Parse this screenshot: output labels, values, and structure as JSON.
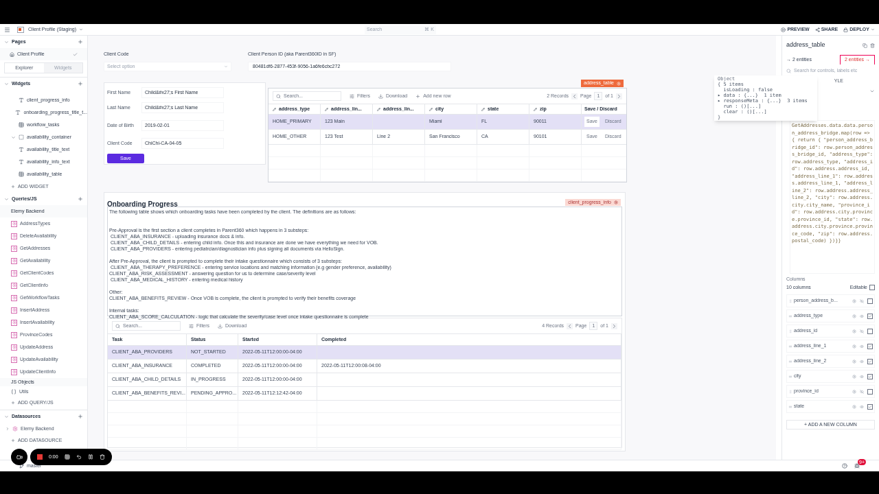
{
  "topbar": {
    "app_name": "Client Profile (Staging)",
    "search_placeholder": "Search",
    "search_shortcut": "⌘ K",
    "actions": [
      {
        "kind": "preview",
        "label": "PREVIEW"
      },
      {
        "kind": "share",
        "label": "SHARE"
      },
      {
        "kind": "deploy",
        "label": "DEPLOY"
      }
    ]
  },
  "sidebar": {
    "pages": {
      "title": "Pages",
      "items": [
        {
          "label": "Client Profile",
          "selected": true
        }
      ]
    },
    "tabs": [
      {
        "label": "Explorer",
        "selected": true
      },
      {
        "label": "Widgets",
        "selected": false
      }
    ],
    "widgets": {
      "title": "Widgets",
      "items": [
        {
          "kind": "text",
          "label": "client_progress_info"
        },
        {
          "kind": "text",
          "label": "onboarding_progress_title_t..."
        },
        {
          "kind": "table",
          "label": "workflow_tasks"
        },
        {
          "kind": "container",
          "label": "availability_container",
          "children": [
            {
              "kind": "text",
              "label": "availability_title_text"
            },
            {
              "kind": "text",
              "label": "availability_info_text"
            },
            {
              "kind": "table",
              "label": "availability_table"
            }
          ]
        }
      ],
      "add": "ADD WIDGET"
    },
    "queries": {
      "title": "Queries/JS",
      "group": "Elemy Backend",
      "items": [
        "AddressTypes",
        "DeleteAvailability",
        "GetAddresses",
        "GetAvailability",
        "GetClientCodes",
        "GetClientInfo",
        "GetWorkflowTasks",
        "InsertAddress",
        "InsertAvailability",
        "ProvinceCodes",
        "UpdateAddress",
        "UpdateAvailability",
        "UpdateClientInfo"
      ],
      "js_group": "JS Objects",
      "js_items": [
        "Utils"
      ],
      "add": "ADD QUERY/JS"
    },
    "datasources": {
      "title": "Datasources",
      "items": [
        "Elemy Backend"
      ],
      "add": "ADD DATASOURCE"
    },
    "branch": "master"
  },
  "client_code": {
    "label": "Client Code",
    "placeholder": "Select option"
  },
  "person_id": {
    "label": "Client Person ID (aka Parent360ID in SF)",
    "value": "80481df6-2877-453f-9056-1a6fe6cbc272"
  },
  "form": {
    "fields": [
      {
        "label": "First Name",
        "value": "Child&#x27;s First Name"
      },
      {
        "label": "Last Name",
        "value": "Child&#x27;s Last Name"
      },
      {
        "label": "Date of Birth",
        "value": "2019-02-01"
      },
      {
        "label": "Client Code",
        "value": "ChiChi-CA-04-05"
      }
    ],
    "save": "Save"
  },
  "address_table": {
    "badge": "address_table",
    "search_placeholder": "Search...",
    "filters": "Filters",
    "download": "Download",
    "add_row": "Add new row",
    "records": "2 Records",
    "page_label": "Page",
    "page": "1",
    "page_of": "of 1",
    "columns": [
      "address_type",
      "address_lin...",
      "address_lin...",
      "city",
      "state",
      "zip"
    ],
    "action_column": "Save / Discard",
    "actions_disabled": true,
    "rows": [
      {
        "cells": [
          "HOME_PRIMARY",
          "123 Main",
          "",
          "Miami",
          "FL",
          "90011"
        ],
        "selected": true,
        "actions": [
          "Save",
          "Discard"
        ]
      },
      {
        "cells": [
          "HOME_OTHER",
          "123 Test",
          "Line 2",
          "San Francisco",
          "CA",
          "90101"
        ],
        "selected": false,
        "actions": [
          "Save",
          "Discard"
        ]
      }
    ]
  },
  "onboarding": {
    "title": "Onboarding Progress",
    "badge": "client_progress_info",
    "paragraphs": [
      [
        "The following table shows which onboarding tasks have been completed by the client. The definitions are as follows:"
      ],
      [
        "Pre-Approval is the first section a client completes in Parent360 which happens in 3 substeps:",
        " CLIENT_ABA_INSURANCE - uploading insurance docs & info.",
        " CLIENT_ABA_CHILD_DETAILS - entering child info. Once this and insurance are done we have everything we need for VOB.",
        " CLIENT_ABA_PROVIDERS - entering pediatrcian/diagnostician info plus signing all documents via HelloSign."
      ],
      [
        "After Pre-Approval, the client is prompted to complete their intake questionnaire which consists of 3 substeps:",
        " CLIENT_ABA_THERAPY_PREFERENCE - entering service locations and matching information (e.g gender preference, availability)",
        "CLIENT_ABA_RISK_ASSESSMENT - answering question for us to determine case/severity level",
        " CLIENT_ABA_MEDICAL_HISTORY - entering medical history"
      ],
      [
        "Other:",
        "CLIENT_ABA_BENEFITS_REVIEW - Once VOB is complete, the client is prompted to verify their benefits coverage"
      ],
      [
        "Internal tasks:",
        "CLIENT_ABA_SCORE_CALCULATION - logic that calculate the severity/case level once intake questionnaire is complete"
      ]
    ],
    "table": {
      "search_placeholder": "Search...",
      "filters": "Filters",
      "download": "Download",
      "records": "4 Records",
      "page_label": "Page",
      "page": "1",
      "page_of": "of 1",
      "columns": [
        "Task",
        "Status",
        "Started",
        "Completed"
      ],
      "rows": [
        {
          "cells": [
            "CLIENT_ABA_PROVIDERS",
            "NOT_STARTED",
            "2022-05-11T12:00:00-04:00",
            ""
          ],
          "selected": true
        },
        {
          "cells": [
            "CLIENT_ABA_INSURANCE",
            "COMPLETED",
            "2022-05-11T12:00:00-04:00",
            "2022-05-11T12:00:08-04:00"
          ],
          "selected": false
        },
        {
          "cells": [
            "CLIENT_ABA_CHILD_DETAILS",
            "IN_PROGRESS",
            "2022-05-11T12:00:00-04:00",
            ""
          ],
          "selected": false
        },
        {
          "cells": [
            "CLIENT_ABA_BENEFITS_REVI...",
            "PENDING_APPRO...",
            "2022-05-11T12:12:42-04:00",
            ""
          ],
          "selected": false
        }
      ]
    }
  },
  "property_pane": {
    "title": "address_table",
    "entities_in": "→ 2 entities",
    "entities_out": "2 entities →",
    "search_placeholder": "Search for controls, labels etc",
    "tab": "YLE",
    "code": "GetAddresses.data.data.person_address_bridge.map(row => { return { \"person_address_bridge_id\": row.person_address_bridge_id,  \"address_type\": row.address_type, \"address_id\": row.address.address_id, \"address_line_1\": row.address.address_line_1, \"address_line_2\": row.address.address_line_2, \"city\": row.address.city.city_name, \"province_id\": row.address.city.province.province_id,  \"state\": row.address.city.province.province_code,  \"zip\": row.address.postal_code) })}}",
    "columns_title": "Columns",
    "columns_count": "10 columns",
    "editable_label": "Editable",
    "editable_all": false,
    "columns": [
      {
        "name": "person_address_b...",
        "visible": false,
        "editable": false
      },
      {
        "name": "address_type",
        "visible": true,
        "editable": true
      },
      {
        "name": "address_id",
        "visible": false,
        "editable": false
      },
      {
        "name": "address_line_1",
        "visible": true,
        "editable": true
      },
      {
        "name": "address_line_2",
        "visible": true,
        "editable": true
      },
      {
        "name": "city",
        "visible": true,
        "editable": true
      },
      {
        "name": "province_id",
        "visible": false,
        "editable": false
      },
      {
        "name": "state",
        "visible": true,
        "editable": true
      }
    ],
    "add_column": "+ ADD A NEW COLUMN"
  },
  "object_popup": {
    "title": "Object",
    "lines": [
      "{ 5 items",
      "  isLoading : false",
      "▸ data : {...}  1 item",
      "▸ responseMeta : {...}  3 items",
      "  run : ()[...]",
      "  clear : ()[...]",
      "}"
    ]
  },
  "recorder": {
    "time": "0:00"
  },
  "status_bar": {
    "notifications": "9+"
  }
}
